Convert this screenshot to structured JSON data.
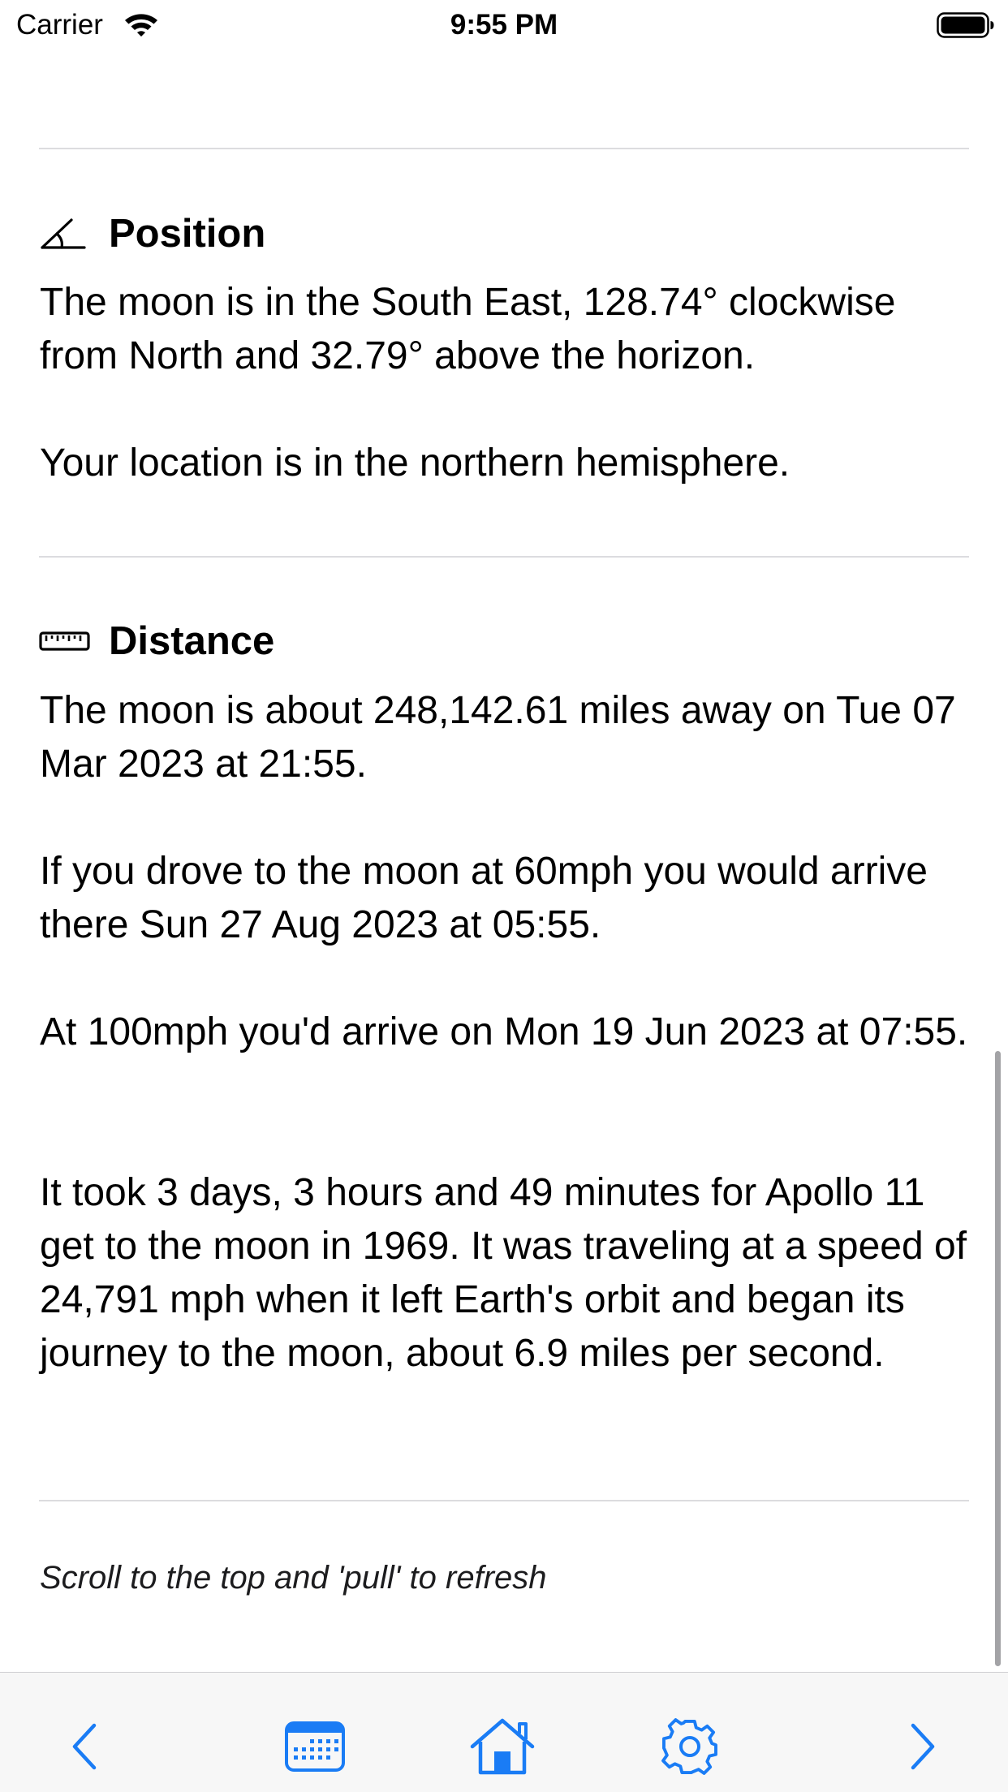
{
  "status_bar": {
    "carrier": "Carrier",
    "time": "9:55 PM"
  },
  "position": {
    "title": "Position",
    "icon": "angle-icon",
    "paragraphs": [
      "The moon is in the South East, 128.74° clockwise from North and 32.79° above the horizon.",
      "Your location is in the northern hemisphere."
    ]
  },
  "distance": {
    "title": "Distance",
    "icon": "ruler-icon",
    "paragraphs": [
      "The moon is about 248,142.61 miles away on Tue 07 Mar 2023 at 21:55.",
      "If you drove to the moon at 60mph you would arrive there Sun 27 Aug 2023 at 05:55.",
      "At 100mph you'd arrive on Mon 19 Jun 2023 at 07:55.",
      "It took 3 days, 3 hours and 49 minutes for Apollo 11 get to the moon in 1969. It was traveling at a speed of 24,791 mph when it left Earth's orbit and began its journey to the moon, about 6.9 miles per second."
    ]
  },
  "footer": {
    "hint": "Scroll to the top and 'pull' to refresh"
  },
  "toolbar": {
    "items": [
      "chevron-left-icon",
      "calendar-icon",
      "home-icon",
      "gear-icon",
      "chevron-right-icon"
    ]
  },
  "colors": {
    "accent": "#1a7cf5",
    "divider": "#dcdcdf",
    "toolbar_background": "#f7f7f7"
  }
}
